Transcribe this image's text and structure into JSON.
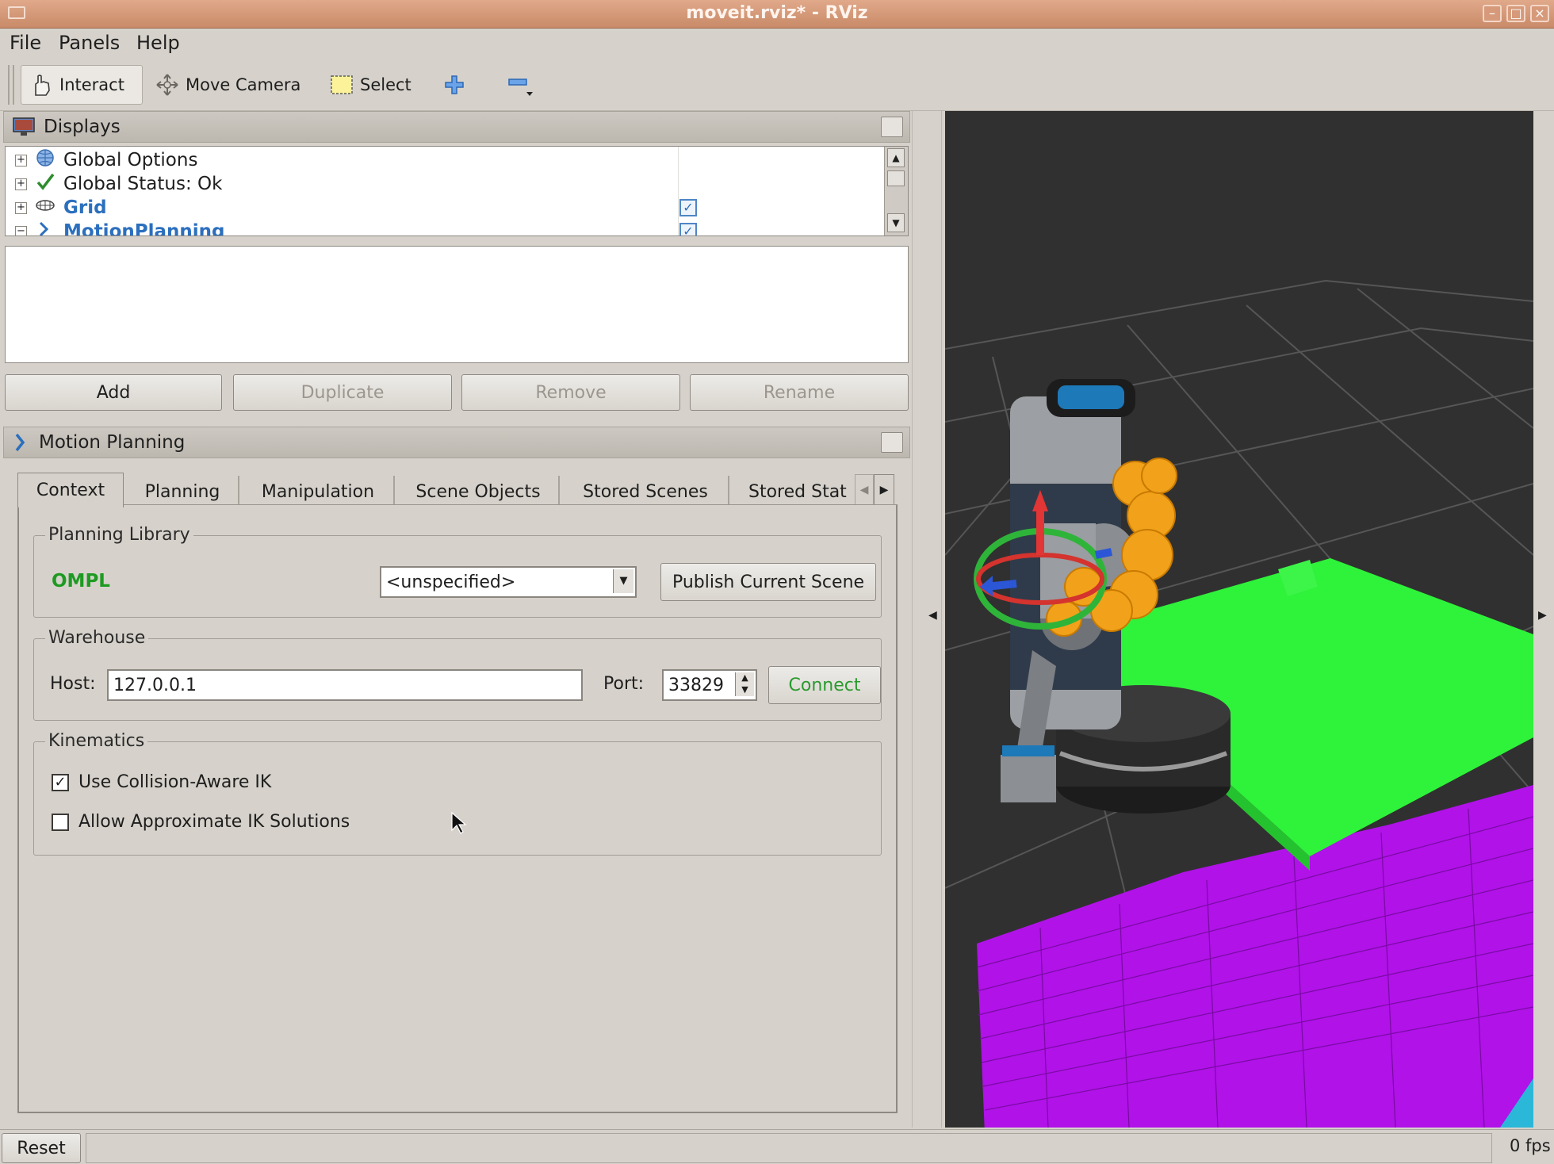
{
  "window": {
    "title": "moveit.rviz* - RViz"
  },
  "menu": {
    "file": "File",
    "panels": "Panels",
    "help": "Help"
  },
  "toolbar": {
    "interact": "Interact",
    "move_camera": "Move Camera",
    "select": "Select"
  },
  "displays": {
    "title": "Displays",
    "items": [
      {
        "label": "Global Options",
        "icon": "globe-icon",
        "checked": null
      },
      {
        "label": "Global Status: Ok",
        "icon": "checkmark-icon",
        "checked": null
      },
      {
        "label": "Grid",
        "icon": "grid-icon",
        "checked": true
      },
      {
        "label": "MotionPlanning",
        "icon": "motion-planning-icon",
        "checked": true
      }
    ],
    "buttons": {
      "add": "Add",
      "duplicate": "Duplicate",
      "remove": "Remove",
      "rename": "Rename"
    }
  },
  "motion_planning": {
    "title": "Motion Planning",
    "tabs": [
      "Context",
      "Planning",
      "Manipulation",
      "Scene Objects",
      "Stored Scenes",
      "Stored Stat"
    ],
    "active_tab": "Context",
    "planning_library": {
      "title": "Planning Library",
      "library": "OMPL",
      "planner": "<unspecified>",
      "publish_button": "Publish Current Scene"
    },
    "warehouse": {
      "title": "Warehouse",
      "host_label": "Host:",
      "host": "127.0.0.1",
      "port_label": "Port:",
      "port": "33829",
      "connect_button": "Connect"
    },
    "kinematics": {
      "title": "Kinematics",
      "collision_aware_label": "Use Collision-Aware IK",
      "collision_aware": true,
      "approx_label": "Allow Approximate IK Solutions",
      "approx": false
    }
  },
  "status": {
    "reset": "Reset",
    "fps": "0 fps"
  },
  "colors": {
    "accent_blue": "#2b6fbe",
    "ompl_green": "#1e9a22",
    "table_green": "#2ff23a",
    "octomap_purple": "#b012e8",
    "viewport_bg": "#303030"
  }
}
